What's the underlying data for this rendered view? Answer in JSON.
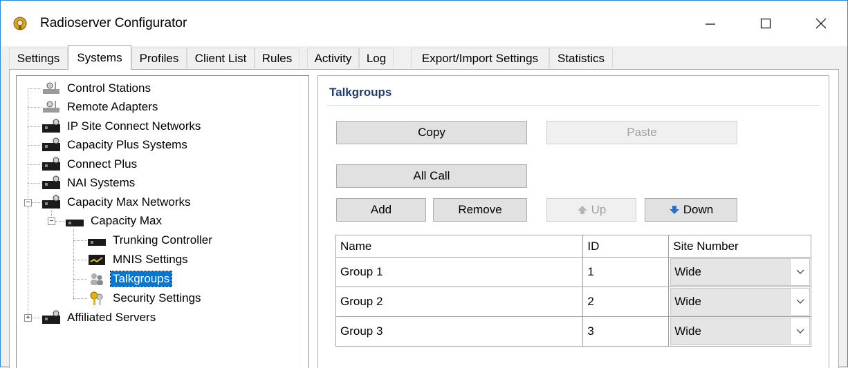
{
  "window": {
    "title": "Radioserver Configurator",
    "icon": "radioserver-app-icon",
    "controls": {
      "minimize": "minimize-icon",
      "maximize": "maximize-icon",
      "close": "close-icon"
    }
  },
  "tabs": [
    {
      "label": "Settings"
    },
    {
      "label": "Systems",
      "active": true
    },
    {
      "label": "Profiles"
    },
    {
      "label": "Client List"
    },
    {
      "label": "Rules"
    },
    {
      "label": "Activity"
    },
    {
      "label": "Log"
    },
    {
      "label": "Export/Import Settings"
    },
    {
      "label": "Statistics"
    }
  ],
  "tree": {
    "items": [
      {
        "label": "Control Stations",
        "icon": "radio-station-icon"
      },
      {
        "label": "Remote Adapters",
        "icon": "radio-station-icon"
      },
      {
        "label": "IP Site Connect Networks",
        "icon": "network-icon"
      },
      {
        "label": "Capacity Plus Systems",
        "icon": "network-icon"
      },
      {
        "label": "Connect Plus",
        "icon": "network-icon"
      },
      {
        "label": "NAI Systems",
        "icon": "network-icon"
      },
      {
        "label": "Capacity Max Networks",
        "icon": "network-icon",
        "expanded": true
      },
      {
        "label": "Capacity Max",
        "icon": "network-icon",
        "expanded": true
      },
      {
        "label": "Trunking Controller",
        "icon": "network-icon"
      },
      {
        "label": "MNIS Settings",
        "icon": "monitor-icon"
      },
      {
        "label": "Talkgroups",
        "icon": "users-icon",
        "selected": true
      },
      {
        "label": "Security Settings",
        "icon": "keys-icon"
      },
      {
        "label": "Affiliated Servers",
        "icon": "network-icon",
        "expanded": false
      }
    ]
  },
  "talkgroups": {
    "title": "Talkgroups",
    "buttons": {
      "copy": "Copy",
      "paste": "Paste",
      "all_call": "All Call",
      "add": "Add",
      "remove": "Remove",
      "up": "Up",
      "down": "Down"
    },
    "columns": [
      "Name",
      "ID",
      "Site Number"
    ],
    "rows": [
      {
        "name": "Group 1",
        "id": "1",
        "site": "Wide"
      },
      {
        "name": "Group 2",
        "id": "2",
        "site": "Wide"
      },
      {
        "name": "Group 3",
        "id": "3",
        "site": "Wide"
      }
    ]
  }
}
